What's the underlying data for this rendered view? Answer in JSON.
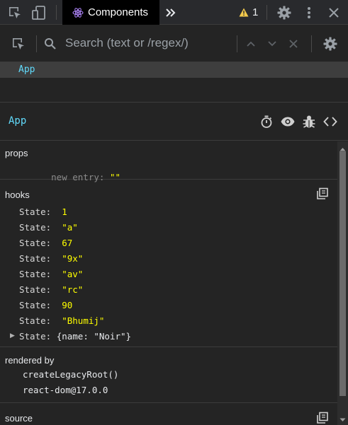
{
  "topbar": {
    "active_tab": "Components",
    "warning_count": "1"
  },
  "search": {
    "placeholder": "Search (text or /regex/)"
  },
  "tree": {
    "selected": "App"
  },
  "inspected": {
    "name": "App"
  },
  "props": {
    "title": "props",
    "new_entry_label": "new entry",
    "new_entry_value": "\"\""
  },
  "hooks": {
    "title": "hooks",
    "items": [
      {
        "label": "State:",
        "value": "1"
      },
      {
        "label": "State:",
        "value": "\"a\""
      },
      {
        "label": "State:",
        "value": "67"
      },
      {
        "label": "State:",
        "value": "\"9x\""
      },
      {
        "label": "State:",
        "value": "\"av\""
      },
      {
        "label": "State:",
        "value": "\"rc\""
      },
      {
        "label": "State:",
        "value": "90"
      },
      {
        "label": "State:",
        "value": "\"Bhumij\""
      },
      {
        "label": "State:",
        "value": "{name: \"Noir\"}"
      }
    ]
  },
  "rendered_by": {
    "title": "rendered by",
    "items": [
      "createLegacyRoot()",
      "react-dom@17.0.0"
    ]
  },
  "source": {
    "title": "source"
  },
  "icons": {
    "inspect": "element-picker-icon",
    "device": "device-toolbar-icon",
    "react": "react-logo-icon",
    "overflow": "chevron-double-right-icon",
    "warning": "warning-icon",
    "settings": "gear-icon",
    "menu": "kebab-menu-icon",
    "close": "close-icon"
  },
  "colors": {
    "accent": "#61dafb",
    "value": "#ffff00",
    "warning": "#f2c94c"
  }
}
